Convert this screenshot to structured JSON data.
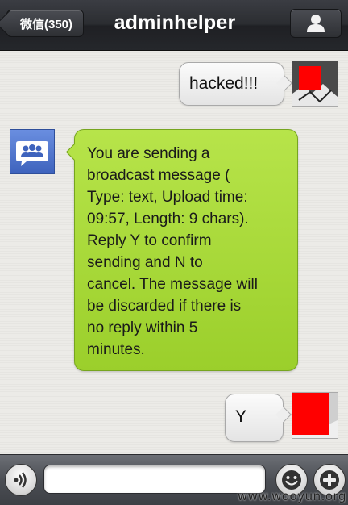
{
  "header": {
    "back_label": "微信(350)",
    "title": "adminhelper",
    "profile_icon": "person-icon"
  },
  "messages": [
    {
      "side": "right",
      "text": "hacked!!!"
    },
    {
      "side": "left",
      "text": "You are sending a\nbroadcast message (\nType: text, Upload time:\n09:57, Length: 9 chars).\nReply Y to confirm\nsending and N to\ncancel. The message will\n be discarded if there is\nno reply within 5\nminutes."
    },
    {
      "side": "right",
      "text": "Y"
    }
  ],
  "input_bar": {
    "voice_icon": "voice-icon",
    "input_value": "",
    "emoji_icon": "smiley-icon",
    "add_icon": "plus-icon"
  },
  "watermark": "www.wooyun.org",
  "colors": {
    "bubble_green": "#a8da39",
    "bubble_gray": "#efefef",
    "avatar_red": "#ff0000",
    "broadcast_blue": "#4a6fc5"
  }
}
